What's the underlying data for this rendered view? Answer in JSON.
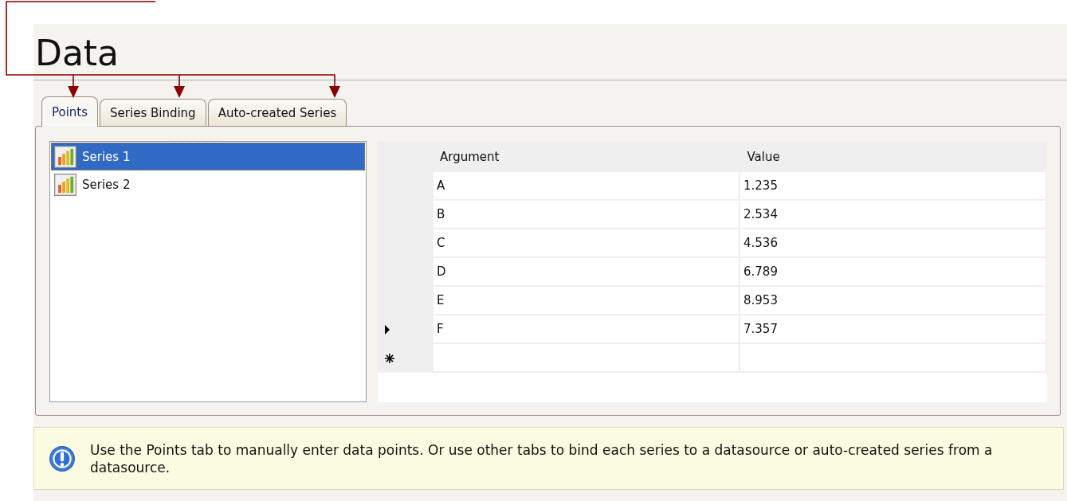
{
  "title": "Data",
  "tabs": [
    {
      "label": "Points",
      "selected": true
    },
    {
      "label": "Series Binding",
      "selected": false
    },
    {
      "label": "Auto-created Series",
      "selected": false
    }
  ],
  "series_list": [
    {
      "label": "Series 1",
      "selected": true
    },
    {
      "label": "Series 2",
      "selected": false
    }
  ],
  "grid": {
    "columns": [
      "Argument",
      "Value"
    ],
    "rows": [
      {
        "argument": "A",
        "value": "1.235",
        "current": false
      },
      {
        "argument": "B",
        "value": "2.534",
        "current": false
      },
      {
        "argument": "C",
        "value": "4.536",
        "current": false
      },
      {
        "argument": "D",
        "value": "6.789",
        "current": false
      },
      {
        "argument": "E",
        "value": "8.953",
        "current": false
      },
      {
        "argument": "F",
        "value": "7.357",
        "current": true
      }
    ],
    "new_row": true
  },
  "info": "Use the Points tab to manually enter data points. Or use other tabs to bind each series to a datasource or auto-created series from a datasource."
}
